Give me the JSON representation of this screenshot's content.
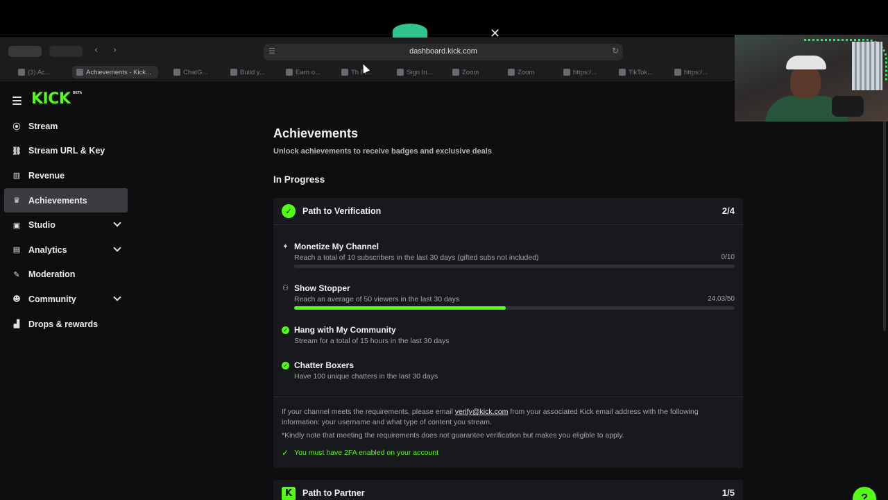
{
  "browser": {
    "url": "dashboard.kick.com",
    "tabs": [
      "(3) Ac...",
      "Achievements - Kick...",
      "ChatG...",
      "Build y...",
      "Earn o...",
      "Th Fi...",
      "Sign In...",
      "Zoom",
      "Zoom",
      "https:/...",
      "TikTok...",
      "https:/..."
    ]
  },
  "app": {
    "logo": "KICK",
    "beta": "BETA"
  },
  "nav": [
    {
      "label": "Stream",
      "icon": "broadcast-icon"
    },
    {
      "label": "Stream URL & Key",
      "icon": "link-icon"
    },
    {
      "label": "Revenue",
      "icon": "revenue-icon"
    },
    {
      "label": "Achievements",
      "icon": "trophy-icon",
      "active": true
    },
    {
      "label": "Studio",
      "icon": "studio-icon",
      "expandable": true
    },
    {
      "label": "Analytics",
      "icon": "analytics-icon",
      "expandable": true
    },
    {
      "label": "Moderation",
      "icon": "wrench-icon"
    },
    {
      "label": "Community",
      "icon": "community-icon",
      "expandable": true
    },
    {
      "label": "Drops & rewards",
      "icon": "drops-icon"
    }
  ],
  "page": {
    "title": "Achievements",
    "subtitle": "Unlock achievements to receive badges and exclusive deals",
    "section": "In Progress"
  },
  "verification": {
    "title": "Path to Verification",
    "count": "2/4",
    "achievements": [
      {
        "title": "Monetize My Channel",
        "desc": "Reach a total of 10 subscribers in the last 30 days (gifted subs not included)",
        "value": "0/10",
        "progress": 0
      },
      {
        "title": "Show Stopper",
        "desc": "Reach an average of 50 viewers in the last 30 days",
        "value": "24.03/50",
        "progress": 0.4806
      },
      {
        "title": "Hang with My Community",
        "desc": "Stream for a total of 15 hours in the last 30 days",
        "done": true
      },
      {
        "title": "Chatter Boxers",
        "desc": "Have 100 unique chatters in the last 30 days",
        "done": true
      }
    ],
    "note_pre": "If your channel meets the requirements, please email ",
    "note_link": "verify@kick.com",
    "note_post": " from your associated Kick email address with the following information: your username and what type of content you stream.",
    "note_2": "*Kindly note that meeting the requirements does not guarantee verification but makes you eligible to apply.",
    "note_3": "You must have 2FA enabled on your account"
  },
  "partner": {
    "title": "Path to Partner",
    "count": "1/5"
  },
  "colors": {
    "accent": "#53fc18",
    "bg": "#0e0e10",
    "card": "#18191c"
  }
}
